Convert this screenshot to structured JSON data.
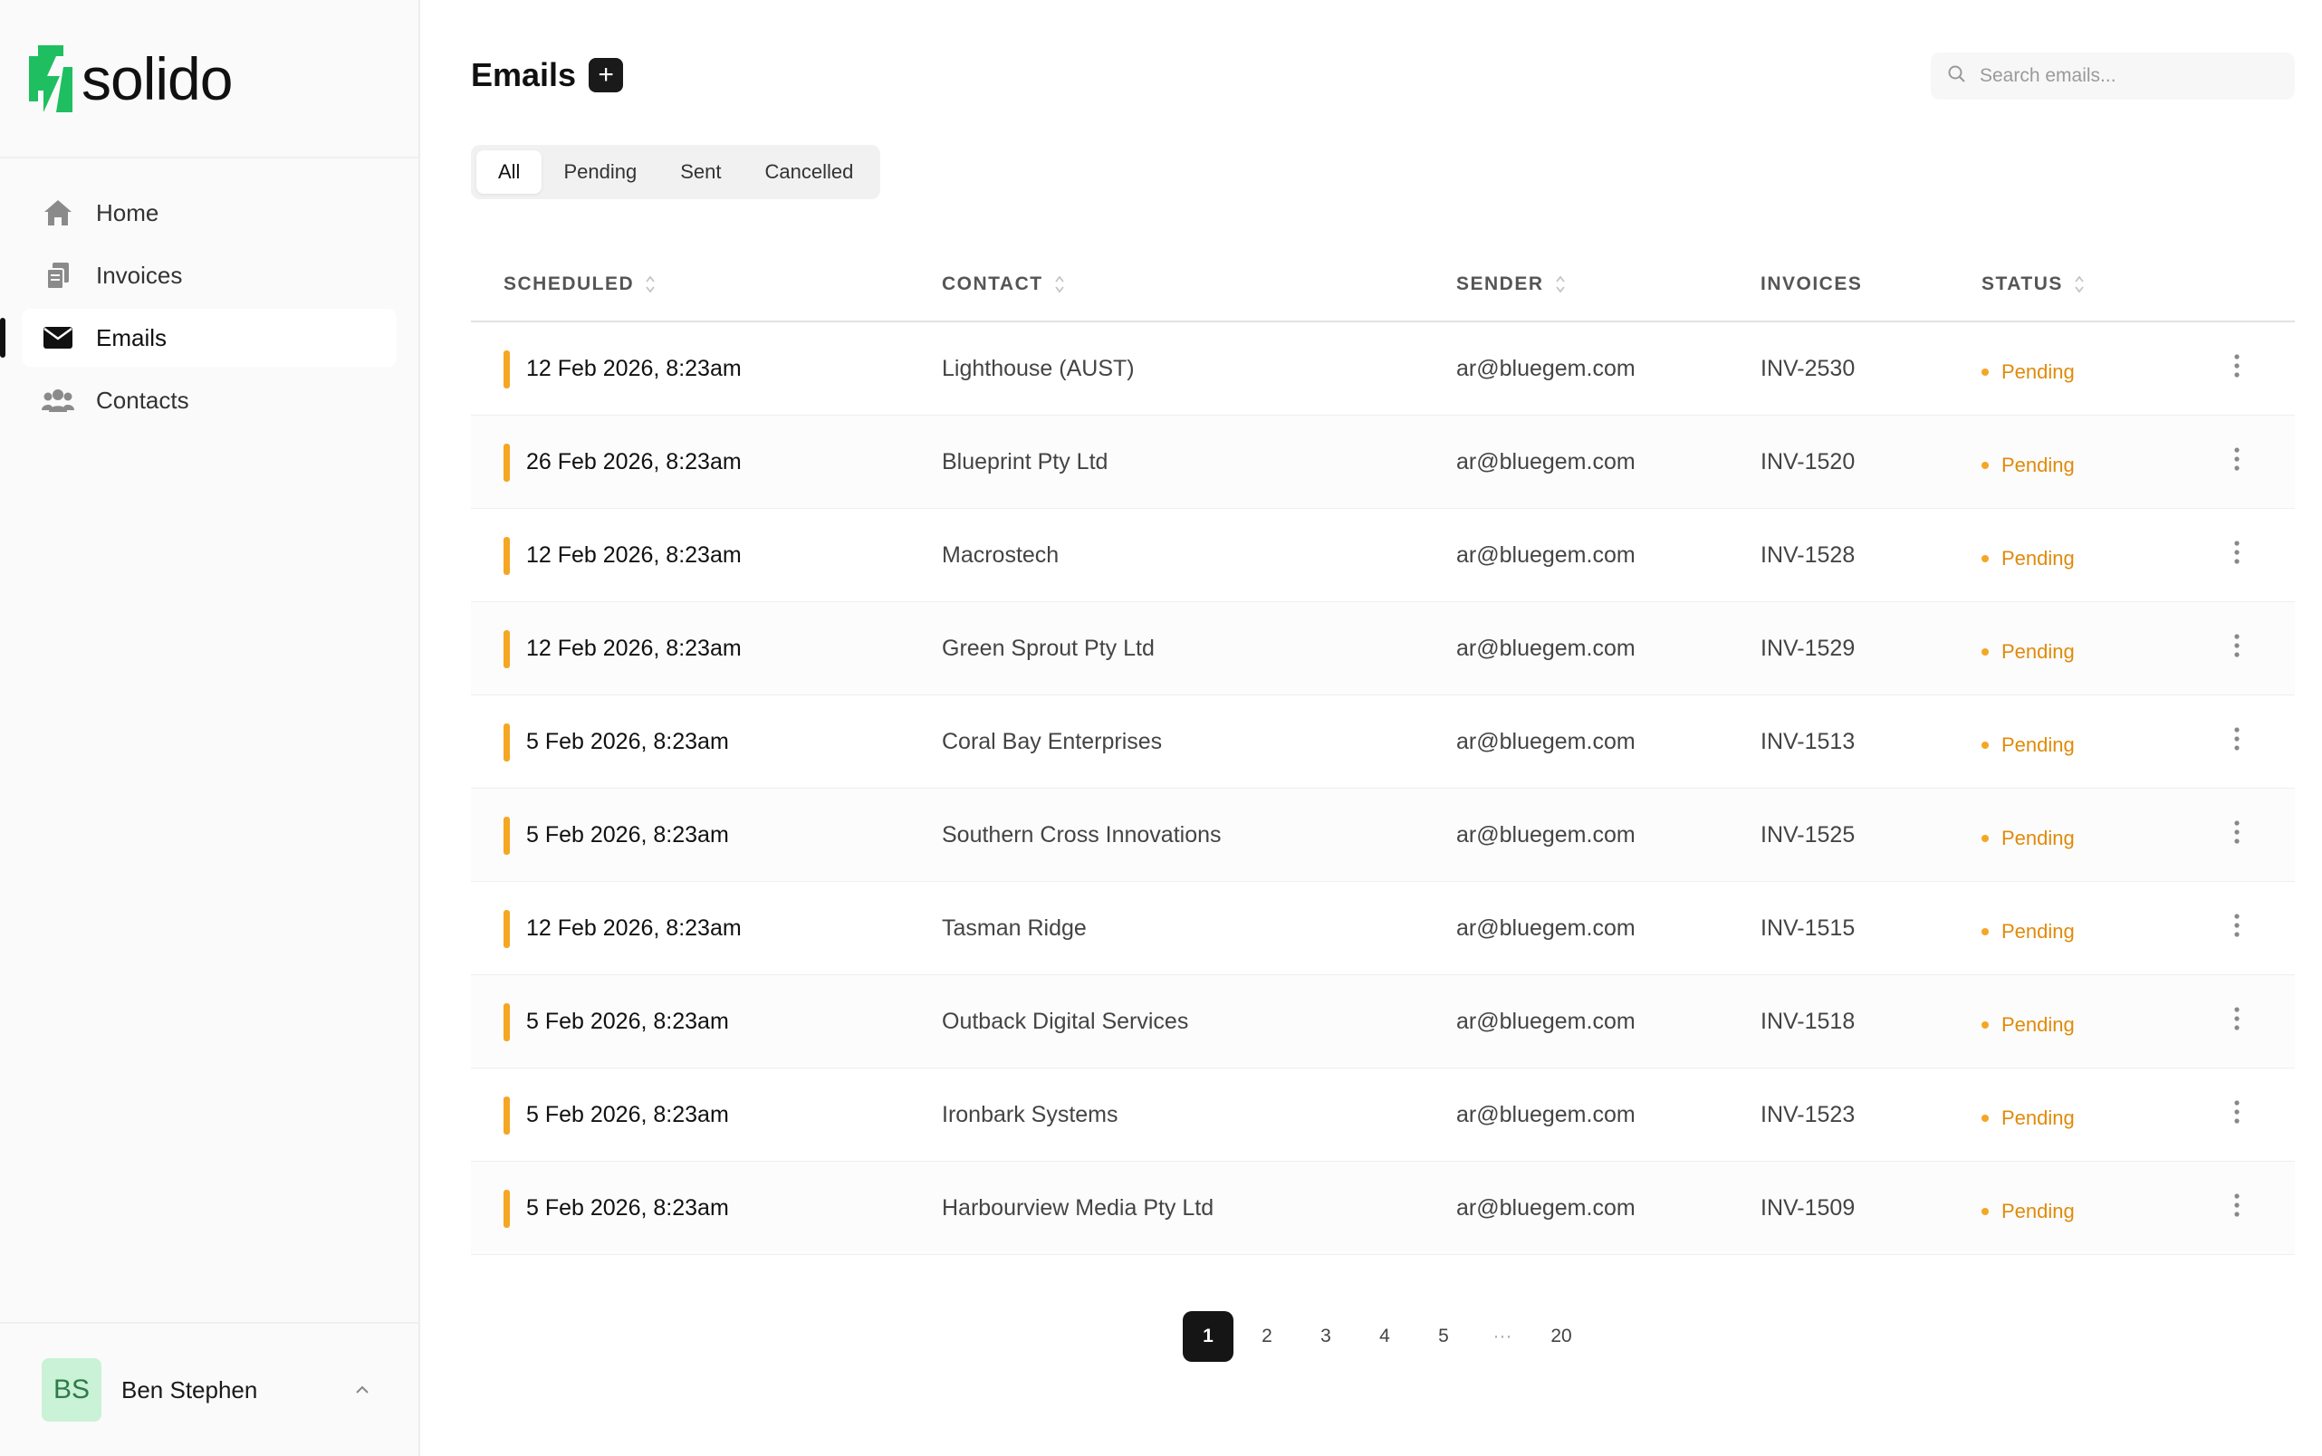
{
  "brand": {
    "name": "solido",
    "accent_color": "#1fbf61"
  },
  "sidebar": {
    "items": [
      {
        "label": "Home",
        "icon": "home-icon",
        "active": false
      },
      {
        "label": "Invoices",
        "icon": "invoices-icon",
        "active": false
      },
      {
        "label": "Emails",
        "icon": "envelope-icon",
        "active": true
      },
      {
        "label": "Contacts",
        "icon": "contacts-icon",
        "active": false
      }
    ]
  },
  "user": {
    "initials": "BS",
    "name": "Ben Stephen"
  },
  "header": {
    "title": "Emails",
    "add_label": "+"
  },
  "search": {
    "placeholder": "Search emails..."
  },
  "tabs": [
    {
      "label": "All",
      "active": true
    },
    {
      "label": "Pending",
      "active": false
    },
    {
      "label": "Sent",
      "active": false
    },
    {
      "label": "Cancelled",
      "active": false
    }
  ],
  "table": {
    "columns": {
      "scheduled": "SCHEDULED",
      "contact": "CONTACT",
      "sender": "SENDER",
      "invoices": "INVOICES",
      "status": "STATUS"
    },
    "status_color": "#e08a0a",
    "rows": [
      {
        "scheduled": "12 Feb 2026, 8:23am",
        "contact": "Lighthouse (AUST)",
        "sender": "ar@bluegem.com",
        "invoice": "INV-2530",
        "status": "Pending"
      },
      {
        "scheduled": "26 Feb 2026, 8:23am",
        "contact": "Blueprint Pty Ltd",
        "sender": "ar@bluegem.com",
        "invoice": "INV-1520",
        "status": "Pending"
      },
      {
        "scheduled": "12 Feb 2026, 8:23am",
        "contact": "Macrostech",
        "sender": "ar@bluegem.com",
        "invoice": "INV-1528",
        "status": "Pending"
      },
      {
        "scheduled": "12 Feb 2026, 8:23am",
        "contact": "Green Sprout Pty Ltd",
        "sender": "ar@bluegem.com",
        "invoice": "INV-1529",
        "status": "Pending"
      },
      {
        "scheduled": "5 Feb 2026, 8:23am",
        "contact": "Coral Bay Enterprises",
        "sender": "ar@bluegem.com",
        "invoice": "INV-1513",
        "status": "Pending"
      },
      {
        "scheduled": "5 Feb 2026, 8:23am",
        "contact": "Southern Cross Innovations",
        "sender": "ar@bluegem.com",
        "invoice": "INV-1525",
        "status": "Pending"
      },
      {
        "scheduled": "12 Feb 2026, 8:23am",
        "contact": "Tasman Ridge",
        "sender": "ar@bluegem.com",
        "invoice": "INV-1515",
        "status": "Pending"
      },
      {
        "scheduled": "5 Feb 2026, 8:23am",
        "contact": "Outback Digital Services",
        "sender": "ar@bluegem.com",
        "invoice": "INV-1518",
        "status": "Pending"
      },
      {
        "scheduled": "5 Feb 2026, 8:23am",
        "contact": "Ironbark Systems",
        "sender": "ar@bluegem.com",
        "invoice": "INV-1523",
        "status": "Pending"
      },
      {
        "scheduled": "5 Feb 2026, 8:23am",
        "contact": "Harbourview Media Pty Ltd",
        "sender": "ar@bluegem.com",
        "invoice": "INV-1509",
        "status": "Pending"
      }
    ]
  },
  "pagination": {
    "pages": [
      "1",
      "2",
      "3",
      "4",
      "5",
      "···",
      "20"
    ],
    "current": "1"
  }
}
